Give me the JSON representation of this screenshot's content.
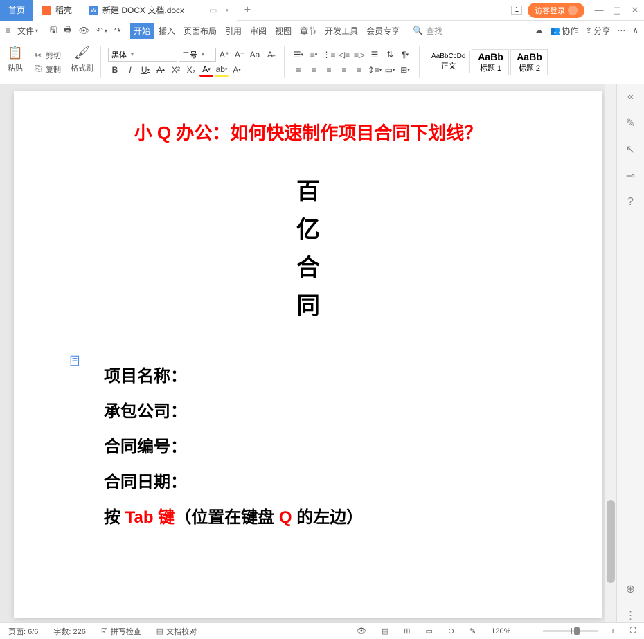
{
  "titlebar": {
    "home_tab": "首页",
    "doc_tab2": "稻壳",
    "doc_tab3": "新建 DOCX 文档.docx",
    "window_index": "1",
    "login": "访客登录"
  },
  "menubar": {
    "file": "文件",
    "search": "查找",
    "collaborate": "协作",
    "share": "分享",
    "ribbon": [
      "开始",
      "插入",
      "页面布局",
      "引用",
      "审阅",
      "视图",
      "章节",
      "开发工具",
      "会员专享"
    ]
  },
  "toolbar": {
    "paste": "粘贴",
    "cut": "剪切",
    "copy": "复制",
    "format_painter": "格式刷",
    "font_name": "黑体",
    "font_size": "二号",
    "style_body_sample": "AaBbCcDd",
    "style_body": "正文",
    "style_h1_sample": "AaBb",
    "style_h1": "标题 1",
    "style_h2_sample": "AaBb",
    "style_h2": "标题 2"
  },
  "document": {
    "title": "小 Q 办公：如何快速制作项目合同下划线？",
    "vertical": [
      "百",
      "亿",
      "合",
      "同"
    ],
    "fields": [
      "项目名称：",
      "承包公司：",
      "合同编号：",
      "合同日期："
    ],
    "instruction_pre": "按 ",
    "instruction_tab": "Tab 键",
    "instruction_mid": "（位置在键盘 ",
    "instruction_q": "Q",
    "instruction_end": " 的左边）"
  },
  "statusbar": {
    "page": "页面: 6/6",
    "words": "字数: 226",
    "spellcheck": "拼写检查",
    "proofread": "文档校对",
    "zoom": "120%"
  }
}
